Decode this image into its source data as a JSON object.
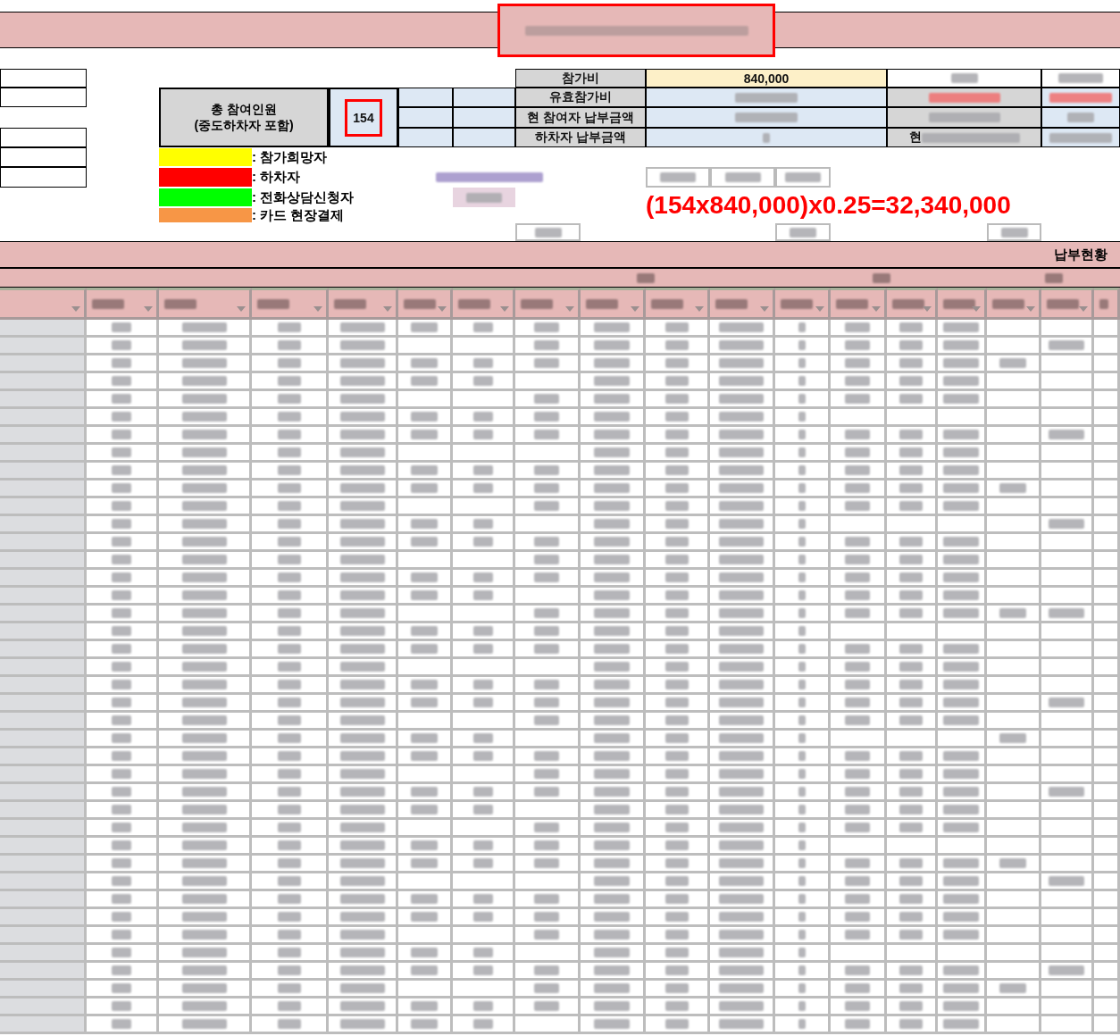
{
  "participants": {
    "label": "총 참여인원",
    "sublabel": "(중도하차자 포함)",
    "value": "154"
  },
  "fees": [
    {
      "label": "참가비",
      "value": "840,000"
    },
    {
      "label": "유효참가비"
    },
    {
      "label": "현 참여자 납부금액"
    },
    {
      "label": "하차자 납부금액"
    }
  ],
  "side_label_fragment": "현",
  "legend": [
    {
      "color": "#ffff00",
      "label": ": 참가희망자"
    },
    {
      "color": "#ff0000",
      "label": ": 하차자"
    },
    {
      "color": "#00ff00",
      "label": ": 전화상담신청자"
    },
    {
      "color": "#f79646",
      "label": ": 카드 현장결제"
    }
  ],
  "formula": "(154x840,000)x0.25=32,340,000",
  "payment_header": "납부현황"
}
